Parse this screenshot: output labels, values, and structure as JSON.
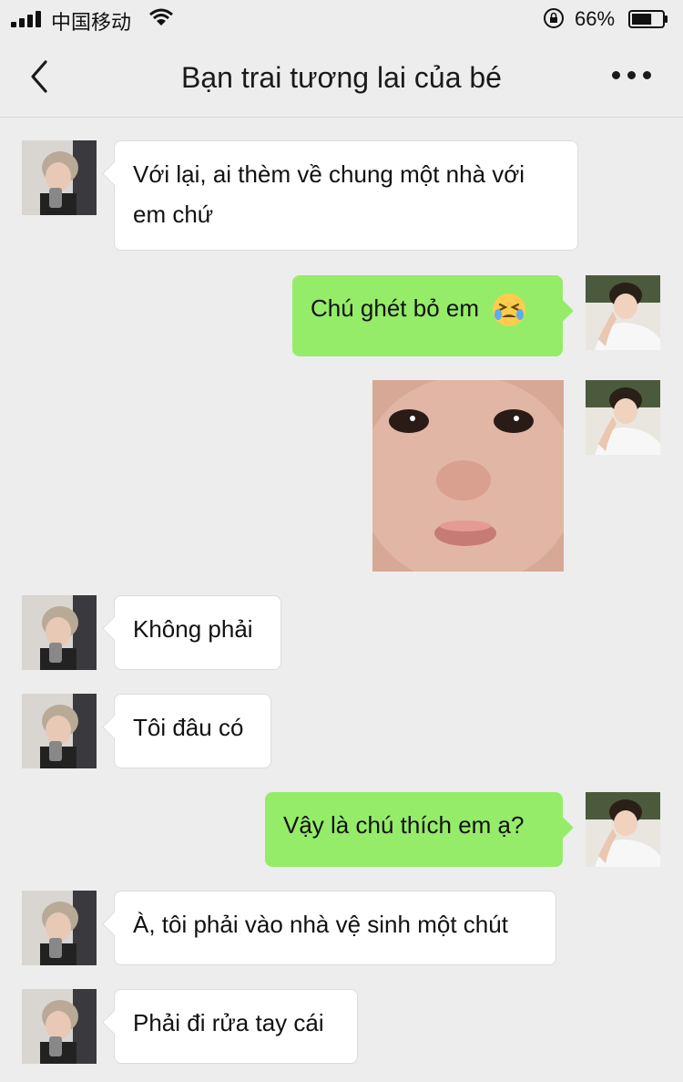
{
  "status_bar": {
    "carrier": "中国移动",
    "battery": "66%",
    "battery_level": 0.66
  },
  "header": {
    "title": "Bạn trai tương lai của bé"
  },
  "messages": [
    {
      "side": "left",
      "text": "Với lại, ai thèm về chung một nhà với em chứ"
    },
    {
      "side": "right",
      "text": "Chú ghét bỏ em",
      "emoji": "crying-face-emoji"
    },
    {
      "side": "right",
      "type": "image",
      "image": "crying-baby-photo"
    },
    {
      "side": "left",
      "text": "Không phải"
    },
    {
      "side": "left",
      "text": "Tôi đâu có"
    },
    {
      "side": "right",
      "text": "Vậy là chú thích em ạ?"
    },
    {
      "side": "left",
      "text": "À, tôi phải vào nhà vệ sinh một chút"
    },
    {
      "side": "left",
      "text": "Phải đi rửa tay cái"
    }
  ],
  "colors": {
    "background": "#ededed",
    "outgoing_bubble": "#95ec69",
    "incoming_bubble": "#ffffff"
  }
}
